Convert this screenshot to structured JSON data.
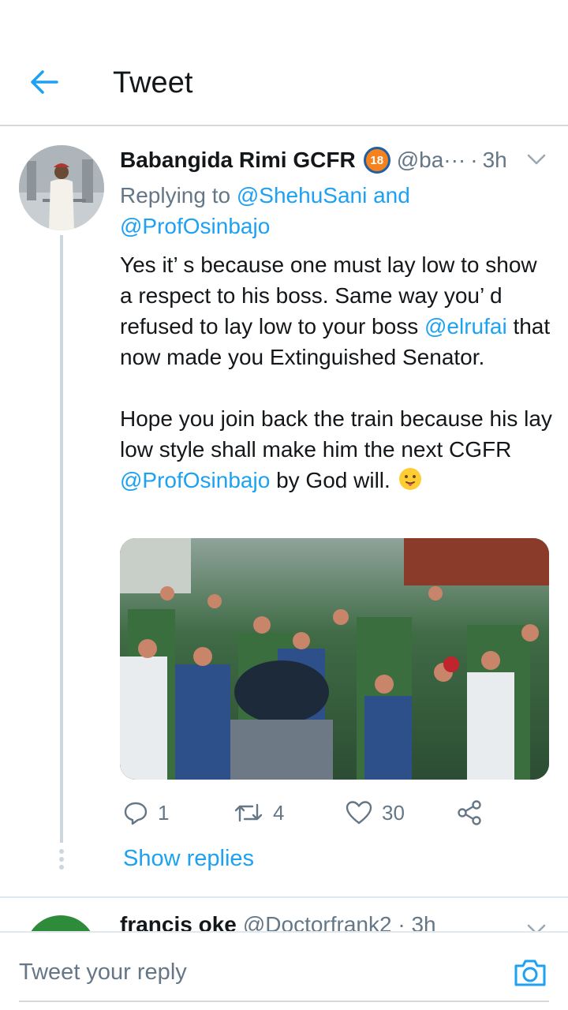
{
  "header": {
    "title": "Tweet",
    "back_icon": "arrow-left-icon"
  },
  "tweet": {
    "name": "Babangida Rimi GCFR",
    "badge": "18",
    "handle": "@ba···",
    "separator": "·",
    "time": "3h",
    "replying_prefix": "Replying to ",
    "replying_to_1": "@ShehuSani",
    "replying_and": " and ",
    "replying_to_2": "@ProfOsinbajo",
    "p1_a": "Yes it’ s because one must lay low to show a respect to his boss. Same way you’ d refused to lay low to your boss ",
    "p1_mention": "@elrufai",
    "p1_b": " that now made you Extinguished Senator.",
    "p2_a": "Hope you join back the train because his lay low style shall make him the next CGFR ",
    "p2_mention": "@ProfOsinbajo",
    "p2_b": " by God will. ",
    "emoji": "slightly-smiling-face",
    "media_description_icon": "photo",
    "replies": "1",
    "retweets": "4",
    "likes": "30",
    "show_replies": "Show replies"
  },
  "next_tweet": {
    "name": "francis oke",
    "handle": "@Doctorfrank2 · 3h"
  },
  "reply_bar": {
    "placeholder": "Tweet your reply",
    "camera_icon": "camera-icon"
  },
  "colors": {
    "accent": "#1da1f2",
    "secondary_text": "#657786",
    "primary_text": "#14171a"
  }
}
